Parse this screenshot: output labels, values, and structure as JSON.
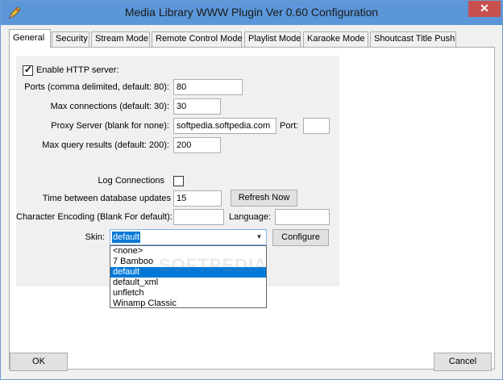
{
  "window": {
    "title": "Media Library WWW Plugin Ver 0.60 Configuration",
    "close_glyph": "✕"
  },
  "tabs": [
    {
      "label": "General"
    },
    {
      "label": "Security"
    },
    {
      "label": "Stream Mode"
    },
    {
      "label": "Remote Control Mode"
    },
    {
      "label": "Playlist Mode"
    },
    {
      "label": "Karaoke Mode"
    },
    {
      "label": "Shoutcast Title Push"
    }
  ],
  "general": {
    "enable_http_label": "Enable HTTP server:",
    "enable_http_checked": true,
    "ports_label": "Ports (comma delimited, default: 80):",
    "ports_value": "80",
    "max_conn_label": "Max connections (default: 30):",
    "max_conn_value": "30",
    "proxy_label": "Proxy Server (blank for none):",
    "proxy_value": "softpedia.softpedia.com",
    "port_label": "Port:",
    "port_value": "",
    "max_query_label": "Max query results (default: 200):",
    "max_query_value": "200",
    "log_label": "Log Connections",
    "log_checked": false,
    "db_updates_label": "Time between database updates",
    "db_updates_value": "15",
    "refresh_label": "Refresh Now",
    "encoding_label": "Character Encoding (Blank For default):",
    "encoding_value": "",
    "language_label": "Language:",
    "language_value": "",
    "skin_label": "Skin:",
    "skin_value": "default",
    "configure_label": "Configure",
    "skin_options": [
      "<none>",
      "7 Bamboo",
      "default",
      "default_xml",
      "unfletch",
      "Winamp Classic"
    ],
    "skin_selected_index": 2
  },
  "footer": {
    "ok_label": "OK",
    "cancel_label": "Cancel"
  },
  "watermark": "SOFTPEDIA"
}
